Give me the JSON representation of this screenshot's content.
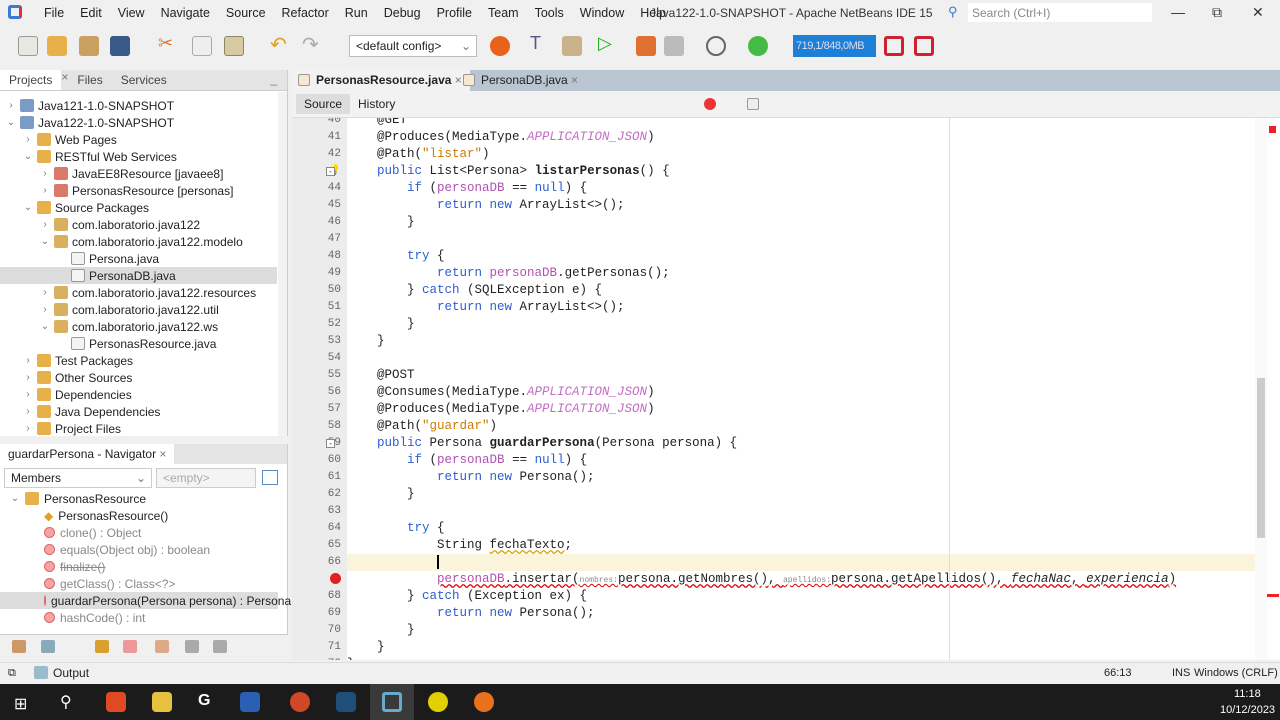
{
  "window": {
    "title": "Java122-1.0-SNAPSHOT - Apache NetBeans IDE 15",
    "search_placeholder": "Search (Ctrl+I)"
  },
  "menu": [
    "File",
    "Edit",
    "View",
    "Navigate",
    "Source",
    "Refactor",
    "Run",
    "Debug",
    "Profile",
    "Team",
    "Tools",
    "Window",
    "Help"
  ],
  "toolbar": {
    "config": "<default config>",
    "memory": "719,1/848,0MB"
  },
  "projects": {
    "tabs": [
      "Projects",
      "Files",
      "Services"
    ],
    "tree": [
      {
        "label": "Java121-1.0-SNAPSHOT",
        "depth": 0,
        "chev": ">",
        "icon": "project-icon"
      },
      {
        "label": "Java122-1.0-SNAPSHOT",
        "depth": 0,
        "chev": "v",
        "icon": "project-icon"
      },
      {
        "label": "Web Pages",
        "depth": 1,
        "chev": ">",
        "icon": "folder-icon"
      },
      {
        "label": "RESTful Web Services",
        "depth": 1,
        "chev": "v",
        "icon": "folder-icon"
      },
      {
        "label": "JavaEE8Resource [javaee8]",
        "depth": 2,
        "chev": ">",
        "icon": "rest-icon"
      },
      {
        "label": "PersonasResource [personas]",
        "depth": 2,
        "chev": ">",
        "icon": "rest-icon"
      },
      {
        "label": "Source Packages",
        "depth": 1,
        "chev": "v",
        "icon": "folder-icon"
      },
      {
        "label": "com.laboratorio.java122",
        "depth": 2,
        "chev": ">",
        "icon": "package-icon"
      },
      {
        "label": "com.laboratorio.java122.modelo",
        "depth": 2,
        "chev": "v",
        "icon": "package-icon"
      },
      {
        "label": "Persona.java",
        "depth": 3,
        "chev": "",
        "icon": "java-file-icon"
      },
      {
        "label": "PersonaDB.java",
        "depth": 3,
        "chev": "",
        "icon": "java-file-icon",
        "selected": true
      },
      {
        "label": "com.laboratorio.java122.resources",
        "depth": 2,
        "chev": ">",
        "icon": "package-icon"
      },
      {
        "label": "com.laboratorio.java122.util",
        "depth": 2,
        "chev": ">",
        "icon": "package-icon"
      },
      {
        "label": "com.laboratorio.java122.ws",
        "depth": 2,
        "chev": "v",
        "icon": "package-icon"
      },
      {
        "label": "PersonasResource.java",
        "depth": 3,
        "chev": "",
        "icon": "java-file-icon"
      },
      {
        "label": "Test Packages",
        "depth": 1,
        "chev": ">",
        "icon": "folder-icon"
      },
      {
        "label": "Other Sources",
        "depth": 1,
        "chev": ">",
        "icon": "folder-icon"
      },
      {
        "label": "Dependencies",
        "depth": 1,
        "chev": ">",
        "icon": "folder-icon"
      },
      {
        "label": "Java Dependencies",
        "depth": 1,
        "chev": ">",
        "icon": "folder-icon"
      },
      {
        "label": "Project Files",
        "depth": 1,
        "chev": ">",
        "icon": "folder-icon"
      }
    ]
  },
  "navigator": {
    "title": "guardarPersona - Navigator",
    "filter": "Members",
    "second": "<empty>",
    "root": "PersonasResource",
    "members": [
      {
        "label": "PersonasResource()",
        "kind": "constructor"
      },
      {
        "label": "clone() : Object",
        "kind": "inherited"
      },
      {
        "label": "equals(Object obj) : boolean",
        "kind": "inherited"
      },
      {
        "label": "finalize()",
        "kind": "deprecated"
      },
      {
        "label": "getClass() : Class<?>",
        "kind": "inherited"
      },
      {
        "label": "guardarPersona(Persona persona) : Persona",
        "kind": "method",
        "selected": true
      },
      {
        "label": "hashCode() : int",
        "kind": "inherited"
      }
    ]
  },
  "editor": {
    "tabs": [
      "PersonasResource.java",
      "PersonaDB.java"
    ],
    "active_tab": 0,
    "views": [
      "Source",
      "History"
    ],
    "first_line": 40,
    "lines": [
      [
        [
          "    @GET",
          ""
        ]
      ],
      [
        [
          "    @Produces(MediaType.",
          ""
        ],
        [
          "APPLICATION_JSON",
          "cst"
        ],
        [
          ")",
          ""
        ]
      ],
      [
        [
          "    @Path(",
          ""
        ],
        [
          "\"listar\"",
          "str"
        ],
        [
          ")",
          ""
        ]
      ],
      [
        [
          "    ",
          ""
        ],
        [
          "public",
          "kw"
        ],
        [
          " List<Persona> ",
          ""
        ],
        [
          "listarPersonas",
          "b"
        ],
        [
          "() {",
          ""
        ]
      ],
      [
        [
          "        ",
          ""
        ],
        [
          "if",
          "kw"
        ],
        [
          " (",
          ""
        ],
        [
          "personaDB",
          "fld"
        ],
        [
          " == ",
          ""
        ],
        [
          "null",
          "kw"
        ],
        [
          ") {",
          ""
        ]
      ],
      [
        [
          "            ",
          ""
        ],
        [
          "return new",
          "kw"
        ],
        [
          " ArrayList<>();",
          ""
        ]
      ],
      [
        [
          "        }",
          ""
        ]
      ],
      [
        [
          "",
          ""
        ]
      ],
      [
        [
          "        ",
          ""
        ],
        [
          "try",
          "kw"
        ],
        [
          " {",
          ""
        ]
      ],
      [
        [
          "            ",
          ""
        ],
        [
          "return",
          "kw"
        ],
        [
          " ",
          ""
        ],
        [
          "personaDB",
          "fld"
        ],
        [
          ".getPersonas();",
          ""
        ]
      ],
      [
        [
          "        } ",
          ""
        ],
        [
          "catch",
          "kw"
        ],
        [
          " (SQLException e) {",
          ""
        ]
      ],
      [
        [
          "            ",
          ""
        ],
        [
          "return new",
          "kw"
        ],
        [
          " ArrayList<>();",
          ""
        ]
      ],
      [
        [
          "        }",
          ""
        ]
      ],
      [
        [
          "    }",
          ""
        ]
      ],
      [
        [
          "",
          ""
        ]
      ],
      [
        [
          "    @POST",
          ""
        ]
      ],
      [
        [
          "    @Consumes(MediaType.",
          ""
        ],
        [
          "APPLICATION_JSON",
          "cst"
        ],
        [
          ")",
          ""
        ]
      ],
      [
        [
          "    @Produces(MediaType.",
          ""
        ],
        [
          "APPLICATION_JSON",
          "cst"
        ],
        [
          ")",
          ""
        ]
      ],
      [
        [
          "    @Path(",
          ""
        ],
        [
          "\"guardar\"",
          "str"
        ],
        [
          ")",
          ""
        ]
      ],
      [
        [
          "    ",
          ""
        ],
        [
          "public",
          "kw"
        ],
        [
          " Persona ",
          ""
        ],
        [
          "guardarPersona",
          "b"
        ],
        [
          "(Persona persona) {",
          ""
        ]
      ],
      [
        [
          "        ",
          ""
        ],
        [
          "if",
          "kw"
        ],
        [
          " (",
          ""
        ],
        [
          "personaDB",
          "fld"
        ],
        [
          " == ",
          ""
        ],
        [
          "null",
          "kw"
        ],
        [
          ") {",
          ""
        ]
      ],
      [
        [
          "            ",
          ""
        ],
        [
          "return new",
          "kw"
        ],
        [
          " Persona();",
          ""
        ]
      ],
      [
        [
          "        }",
          ""
        ]
      ],
      [
        [
          "",
          ""
        ]
      ],
      [
        [
          "        ",
          ""
        ],
        [
          "try",
          "kw"
        ],
        [
          " {",
          ""
        ]
      ],
      [
        [
          "            String ",
          ""
        ],
        [
          "fechaTexto",
          "warn"
        ],
        [
          ";",
          ""
        ]
      ],
      [
        [
          "            ",
          ""
        ]
      ],
      [
        [
          "            ",
          ""
        ],
        [
          "personaDB",
          "fld err"
        ],
        [
          ".insertar(",
          "err"
        ],
        [
          "nombres:",
          "hint err"
        ],
        [
          "persona.getNombres(), ",
          "err"
        ],
        [
          "apellidos:",
          "hint err"
        ],
        [
          "persona.getApellidos(), ",
          "err"
        ],
        [
          "fechaNac",
          "it err"
        ],
        [
          ", ",
          "err"
        ],
        [
          "experiencia",
          "it err"
        ],
        [
          ")",
          "err"
        ]
      ],
      [
        [
          "        } ",
          ""
        ],
        [
          "catch",
          "kw"
        ],
        [
          " (Exception ex) {",
          ""
        ]
      ],
      [
        [
          "            ",
          ""
        ],
        [
          "return new",
          "kw"
        ],
        [
          " Persona();",
          ""
        ]
      ],
      [
        [
          "        }",
          ""
        ]
      ],
      [
        [
          "    }",
          ""
        ]
      ],
      [
        [
          "}",
          ""
        ]
      ]
    ],
    "current_line": 66,
    "hint_line": 43,
    "error_line": 67
  },
  "output": {
    "label": "Output"
  },
  "status": {
    "position": "66:13",
    "mode": "INS",
    "line_endings": "Windows (CRLF)"
  },
  "clock": {
    "time": "11:18",
    "date": "10/12/2023"
  }
}
